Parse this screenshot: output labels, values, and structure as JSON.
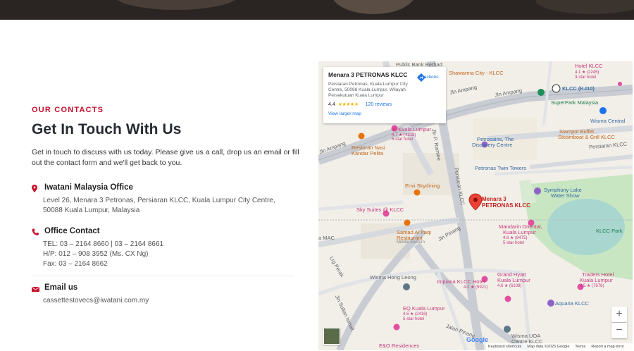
{
  "contact": {
    "eyebrow": "OUR CONTACTS",
    "title": "Get In Touch With Us",
    "intro": "Get in touch to discuss with us today. Please give us a call, drop us an email or fill out the contact form and we'll get back to you.",
    "office": {
      "label": "Iwatani Malaysia Office",
      "address_line1": "Level 26, Menara 3 Petronas, Persiaran KLCC, Kuala Lumpur City Centre,",
      "address_line2": "50088 Kuala Lumpur, Malaysia"
    },
    "phone": {
      "label": "Office Contact",
      "tel": "TEL: 03 – 2164 8660 | 03 – 2164 8661",
      "hp": "H/P: 012 – 908 3952 (Ms. CX Ng)",
      "fax": "Fax: 03 – 2164 8662"
    },
    "email": {
      "label": "Email us",
      "address": "cassettestovecs@iwatani.com.my"
    },
    "accent_color": "#c8102e"
  },
  "map": {
    "card": {
      "name": "Menara 3 PETRONAS KLCC",
      "address": "Persiaran Petronas, Kuala Lumpur City Centre, 50088 Kuala Lumpur, Wilayah Persekutuan Kuala Lumpur",
      "rating": "4.4",
      "stars": "★★★★★",
      "reviews": "120 reviews",
      "view_larger": "View larger map",
      "directions": "Directions"
    },
    "pin_label_1": "Menara 3",
    "pin_label_2": "PETRONAS KLCC",
    "labels": {
      "public_bank": "Public Bank Berhad",
      "shawarma": "Shawarma City - KLCC",
      "jln_ampang": "Jln Ampang",
      "klcc_station": "KLCC (KJ10)",
      "superpark": "SuperPark Malaysia",
      "wisma_central": "Wisma Central",
      "w_kl": "W Kuala Lumpur",
      "w_kl_rating": "4.7 ★ (4318)",
      "w_kl_class": "5-star hotel",
      "petrosains": "Petrosains, The",
      "petrosains2": "Discovery Centre",
      "siampot": "Siampot Buffet",
      "siampot2": "Steamboat & Grill KLCC",
      "persiaran_klcc": "Persiaran KLCC",
      "restoran": "Restoran Nasi",
      "restoran2": "Kandar Pelita",
      "twin_towers": "Petronas Twin Towers",
      "ramlee": "Jln P. Ramlee",
      "envi": "Envi Skydining",
      "symphony": "Symphony Lake",
      "symphony2": "Water Show",
      "sky_suites": "Sky Suites @ KLCC",
      "mandarin": "Mandarin Oriental,",
      "mandarin2": "Kuala Lumpur",
      "mandarin_rating": "4.6 ★ (8475)",
      "mandarin_class": "5-star hotel",
      "klcc_park": "KLCC Park",
      "samad": "Samad Al Iraqi",
      "samad2": "Restaurant",
      "samad3": "Middle Eastern",
      "jln_pinang": "Jln Pinang",
      "jln_perak": "Lrg Perak",
      "wisma_hong_leong": "Wisma Hong Leong",
      "impiana": "Impiana KLCC Hotel",
      "impiana_rating": "4.2 ★ (5921)",
      "grand_hyatt": "Grand Hyatt",
      "grand_hyatt2": "Kuala Lumpur",
      "grand_hyatt_rating": "4.6 ★ (6108)",
      "traders": "Traders Hotel",
      "traders2": "Kuala Lumpur",
      "traders_rating": "4.5 ★ (7678)",
      "aquaria": "Aquaria KLCC",
      "eq": "EQ Kuala Lumpur",
      "eq_rating": "4.6 ★ (2416)",
      "jln_sultan": "Jln Sultan Ismail",
      "jalan_pinang": "Jalan Pinang",
      "wisma_uoa": "Wisma UOA",
      "wisma_uoa2": "Centre KLCC",
      "e_o": "E&O Residences",
      "hotel_klcc": "Hotel KLCC",
      "hotel_klcc_rating": "4.1 ★ (2245)",
      "hotel_klcc_class": "3-star hotel",
      "klcc_label_h": "Impiana",
      "five_star": "5-star hotel"
    },
    "footer": {
      "shortcuts": "Keyboard shortcuts",
      "mapdata": "Map data ©2025 Google",
      "terms": "Terms",
      "report": "Report a map error"
    },
    "google": "Google",
    "zoom_in": "+",
    "zoom_out": "−"
  }
}
